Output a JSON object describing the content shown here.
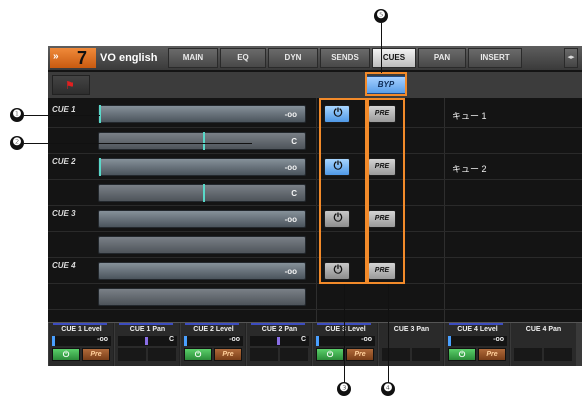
{
  "header": {
    "fast_forward": "»",
    "channel_number": "7",
    "channel_name": "VO english",
    "tabs": [
      {
        "label": "MAIN",
        "active": false
      },
      {
        "label": "EQ",
        "active": false
      },
      {
        "label": "DYN",
        "active": false
      },
      {
        "label": "SENDS",
        "active": false
      },
      {
        "label": "CUES",
        "active": true
      },
      {
        "label": "PAN",
        "active": false
      },
      {
        "label": "INSERT",
        "active": false
      }
    ],
    "scroll_icon": "◂▸"
  },
  "toolbar": {
    "bypass_label": "BYP",
    "flag_icon": "⚑"
  },
  "cues": [
    {
      "label": "CUE 1",
      "level": "-oo",
      "pan": "C",
      "power": "on",
      "pre": "PRE",
      "name": "キュー 1"
    },
    {
      "label": "CUE 2",
      "level": "-oo",
      "pan": "C",
      "power": "on",
      "pre": "PRE",
      "name": "キュー 2"
    },
    {
      "label": "CUE 3",
      "level": "-oo",
      "pan": "",
      "power": "off",
      "pre": "PRE",
      "name": ""
    },
    {
      "label": "CUE 4",
      "level": "-oo",
      "pan": "",
      "power": "off",
      "pre": "PRE",
      "name": ""
    }
  ],
  "power_glyph": "⏻",
  "strip": [
    {
      "title": "CUE 1 Level",
      "value": "-oo",
      "type": "level",
      "power": "⏻",
      "pre": "Pre"
    },
    {
      "title": "CUE 1 Pan",
      "value": "C",
      "type": "pan"
    },
    {
      "title": "CUE 2 Level",
      "value": "-oo",
      "type": "level",
      "power": "⏻",
      "pre": "Pre"
    },
    {
      "title": "CUE 2 Pan",
      "value": "C",
      "type": "pan"
    },
    {
      "title": "CUE 3 Level",
      "value": "-oo",
      "type": "level",
      "power": "⏻",
      "pre": "Pre"
    },
    {
      "title": "CUE 3 Pan",
      "value": "",
      "type": "empty"
    },
    {
      "title": "CUE 4 Level",
      "value": "-oo",
      "type": "level",
      "power": "⏻",
      "pre": "Pre"
    },
    {
      "title": "CUE 4 Pan",
      "value": "",
      "type": "empty"
    }
  ],
  "callouts": [
    "❶",
    "❷",
    "❸",
    "❹",
    "❺"
  ],
  "colors": {
    "accent_orange": "#f28a2a",
    "on_blue": "#5a9ee8",
    "meter_teal": "#59d8c8"
  }
}
